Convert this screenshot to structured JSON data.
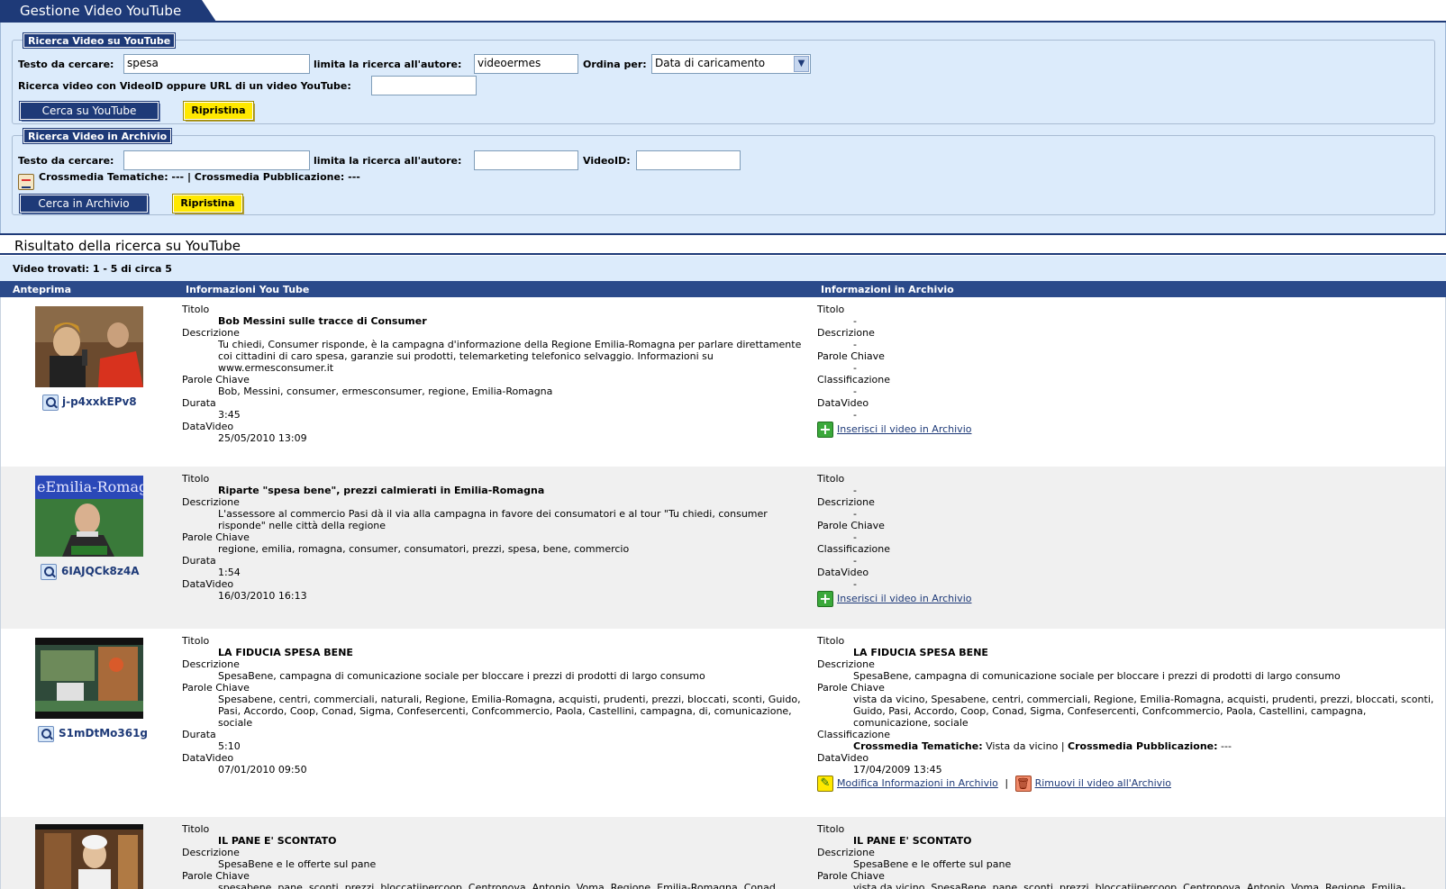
{
  "header": {
    "title": "Gestione Video YouTube"
  },
  "youtube_search": {
    "legend": "Ricerca Video su YouTube",
    "text_label": "Testo da cercare:",
    "text_value": "spesa",
    "author_label": "limita la ricerca all'autore:",
    "author_value": "videoermes",
    "order_label": "Ordina per:",
    "order_value": "Data di caricamento",
    "videoid_label": "Ricerca video con VideoID oppure URL di un video YouTube:",
    "videoid_value": "",
    "search_button": "Cerca su YouTube",
    "reset_button": "Ripristina"
  },
  "archive_search": {
    "legend": "Ricerca Video in Archivio",
    "text_label": "Testo da cercare:",
    "text_value": "",
    "author_label": "limita la ricerca all'autore:",
    "author_value": "",
    "videoid_label": "VideoID:",
    "videoid_value": "",
    "crossmedia_text": "Crossmedia Tematiche: --- | Crossmedia Pubblicazione: ---",
    "search_button": "Cerca in Archivio",
    "reset_button": "Ripristina"
  },
  "results": {
    "heading": "Risultato della ricerca su YouTube",
    "found": "Video trovati: 1 - 5 di circa 5",
    "columns": {
      "preview": "Anteprima",
      "youtube": "Informazioni You Tube",
      "archive": "Informazioni in Archivio"
    },
    "labels": {
      "title": "Titolo",
      "description": "Descrizione",
      "keywords": "Parole Chiave",
      "duration": "Durata",
      "date": "DataVideo",
      "classification": "Classificazione"
    },
    "rows": [
      {
        "video_id": "j-p4xxkEPv8",
        "yt": {
          "title": "Bob Messini sulle tracce di Consumer",
          "description": "Tu chiedi, Consumer risponde, è la campagna d'informazione della Regione Emilia-Romagna per parlare direttamente coi cittadini di caro spesa, garanzie sui prodotti, telemarketing telefonico selvaggio. Informazioni su www.ermesconsumer.it",
          "keywords": "Bob, Messini, consumer, ermesconsumer, regione, Emilia-Romagna",
          "duration": "3:45",
          "date": "25/05/2010 13:09"
        },
        "arc": {
          "title": "-",
          "description": "-",
          "keywords": "-",
          "classification": "-",
          "date": "-"
        },
        "insert_link": "Inserisci il video in Archivio"
      },
      {
        "video_id": "6IAJQCk8z4A",
        "yt": {
          "title": "Riparte \"spesa bene\", prezzi calmierati in Emilia-Romagna",
          "description": "L'assessore al commercio Pasi dà il via alla campagna in favore dei consumatori e al tour \"Tu chiedi, consumer risponde\" nelle città della regione",
          "keywords": "regione, emilia, romagna, consumer, consumatori, prezzi, spesa, bene, commercio",
          "duration": "1:54",
          "date": "16/03/2010 16:13"
        },
        "arc": {
          "title": "-",
          "description": "-",
          "keywords": "-",
          "classification": "-",
          "date": "-"
        },
        "insert_link": "Inserisci il video in Archivio"
      },
      {
        "video_id": "S1mDtMo361g",
        "yt": {
          "title": "LA FIDUCIA SPESA BENE",
          "description": "SpesaBene, campagna di comunicazione sociale per bloccare i prezzi di prodotti di largo consumo",
          "keywords": "Spesabene, centri, commerciali, naturali, Regione, Emilia-Romagna, acquisti, prudenti, prezzi, bloccati, sconti, Guido, Pasi, Accordo, Coop, Conad, Sigma, Confesercenti, Confcommercio, Paola, Castellini, campagna, di, comunicazione, sociale",
          "duration": "5:10",
          "date": "07/01/2010 09:50"
        },
        "arc": {
          "title": "LA FIDUCIA SPESA BENE",
          "description": "SpesaBene, campagna di comunicazione sociale per bloccare i prezzi di prodotti di largo consumo",
          "keywords": "vista da vicino, Spesabene, centri, commerciali, Regione, Emilia-Romagna, acquisti, prudenti, prezzi, bloccati, sconti, Guido, Pasi, Accordo, Coop, Conad, Sigma, Confesercenti, Confcommercio, Paola, Castellini, campagna, comunicazione, sociale",
          "class_tem_label": "Crossmedia Tematiche:",
          "class_tem_value": " Vista da vicino | ",
          "class_pub_label": "Crossmedia Pubblicazione:",
          "class_pub_value": " ---",
          "date": "17/04/2009 13:45"
        },
        "edit_link": "Modifica Informazioni in Archivio",
        "separator": "|",
        "remove_link": "Rimuovi il video all'Archivio"
      },
      {
        "video_id": "",
        "yt": {
          "title": "IL PANE E' SCONTATO",
          "description": "SpesaBene e le offerte sul pane",
          "keywords": "spesabene, pane, sconti, prezzi, bloccatiipercoop, Centronova, Antonio, Voma, Regione, Emilia-Romagna, Conad,"
        },
        "arc": {
          "title": "IL PANE E' SCONTATO",
          "description": "SpesaBene e le offerte sul pane",
          "keywords": "vista da vicino, SpesaBene, pane, sconti, prezzi, bloccatiipercoop, Centronova, Antonio, Voma, Regione, Emilia-"
        }
      }
    ]
  }
}
